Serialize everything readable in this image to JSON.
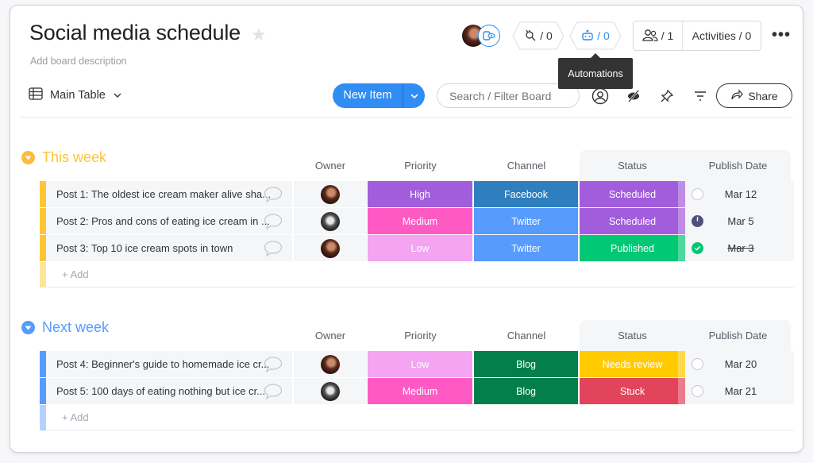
{
  "board": {
    "title": "Social media schedule",
    "description_placeholder": "Add board description"
  },
  "header": {
    "integrations_count": "/ 0",
    "automations_count": "/ 0",
    "members_count": "/ 1",
    "activities_label": "Activities / 0",
    "more_label": "•••",
    "tooltip": "Automations"
  },
  "toolbar": {
    "view_label": "Main Table",
    "new_item_label": "New Item",
    "search_placeholder": "Search / Filter Board",
    "share_label": "Share"
  },
  "columns": {
    "owner": "Owner",
    "priority": "Priority",
    "channel": "Channel",
    "status": "Status",
    "publish_date": "Publish Date"
  },
  "colors": {
    "this_week": "#fdc536",
    "next_week": "#579bfc",
    "priority": {
      "High": "#a25ddc",
      "Medium": "#ff5ac4",
      "Low": "#f4a4f1"
    },
    "channel": {
      "Facebook": "#2f7fbf",
      "Twitter": "#579bfc",
      "Blog": "#037f4c"
    },
    "status": {
      "Scheduled": "#a25ddc",
      "Published": "#00c875",
      "Needs review": "#ffcb00",
      "Stuck": "#e2445c"
    }
  },
  "groups": [
    {
      "title": "This week",
      "add_label": "+ Add",
      "items": [
        {
          "name": "Post 1: The oldest ice cream maker alive sha...",
          "owner": "warm",
          "priority": "High",
          "channel": "Facebook",
          "status": "Scheduled",
          "date": "Mar 12",
          "date_state": "empty"
        },
        {
          "name": "Post 2: Pros and cons of eating ice cream in ...",
          "owner": "bw",
          "priority": "Medium",
          "channel": "Twitter",
          "status": "Scheduled",
          "date": "Mar 5",
          "date_state": "overdue"
        },
        {
          "name": "Post 3: Top 10 ice cream spots in town",
          "owner": "warm",
          "priority": "Low",
          "channel": "Twitter",
          "status": "Published",
          "date": "Mar 3",
          "date_state": "done"
        }
      ]
    },
    {
      "title": "Next week",
      "add_label": "+ Add",
      "items": [
        {
          "name": "Post 4: Beginner's guide to homemade ice cr...",
          "owner": "warm",
          "priority": "Low",
          "channel": "Blog",
          "status": "Needs review",
          "date": "Mar 20",
          "date_state": "empty"
        },
        {
          "name": "Post 5: 100 days of eating nothing but ice cr...",
          "owner": "bw",
          "priority": "Medium",
          "channel": "Blog",
          "status": "Stuck",
          "date": "Mar 21",
          "date_state": "empty"
        }
      ]
    }
  ]
}
